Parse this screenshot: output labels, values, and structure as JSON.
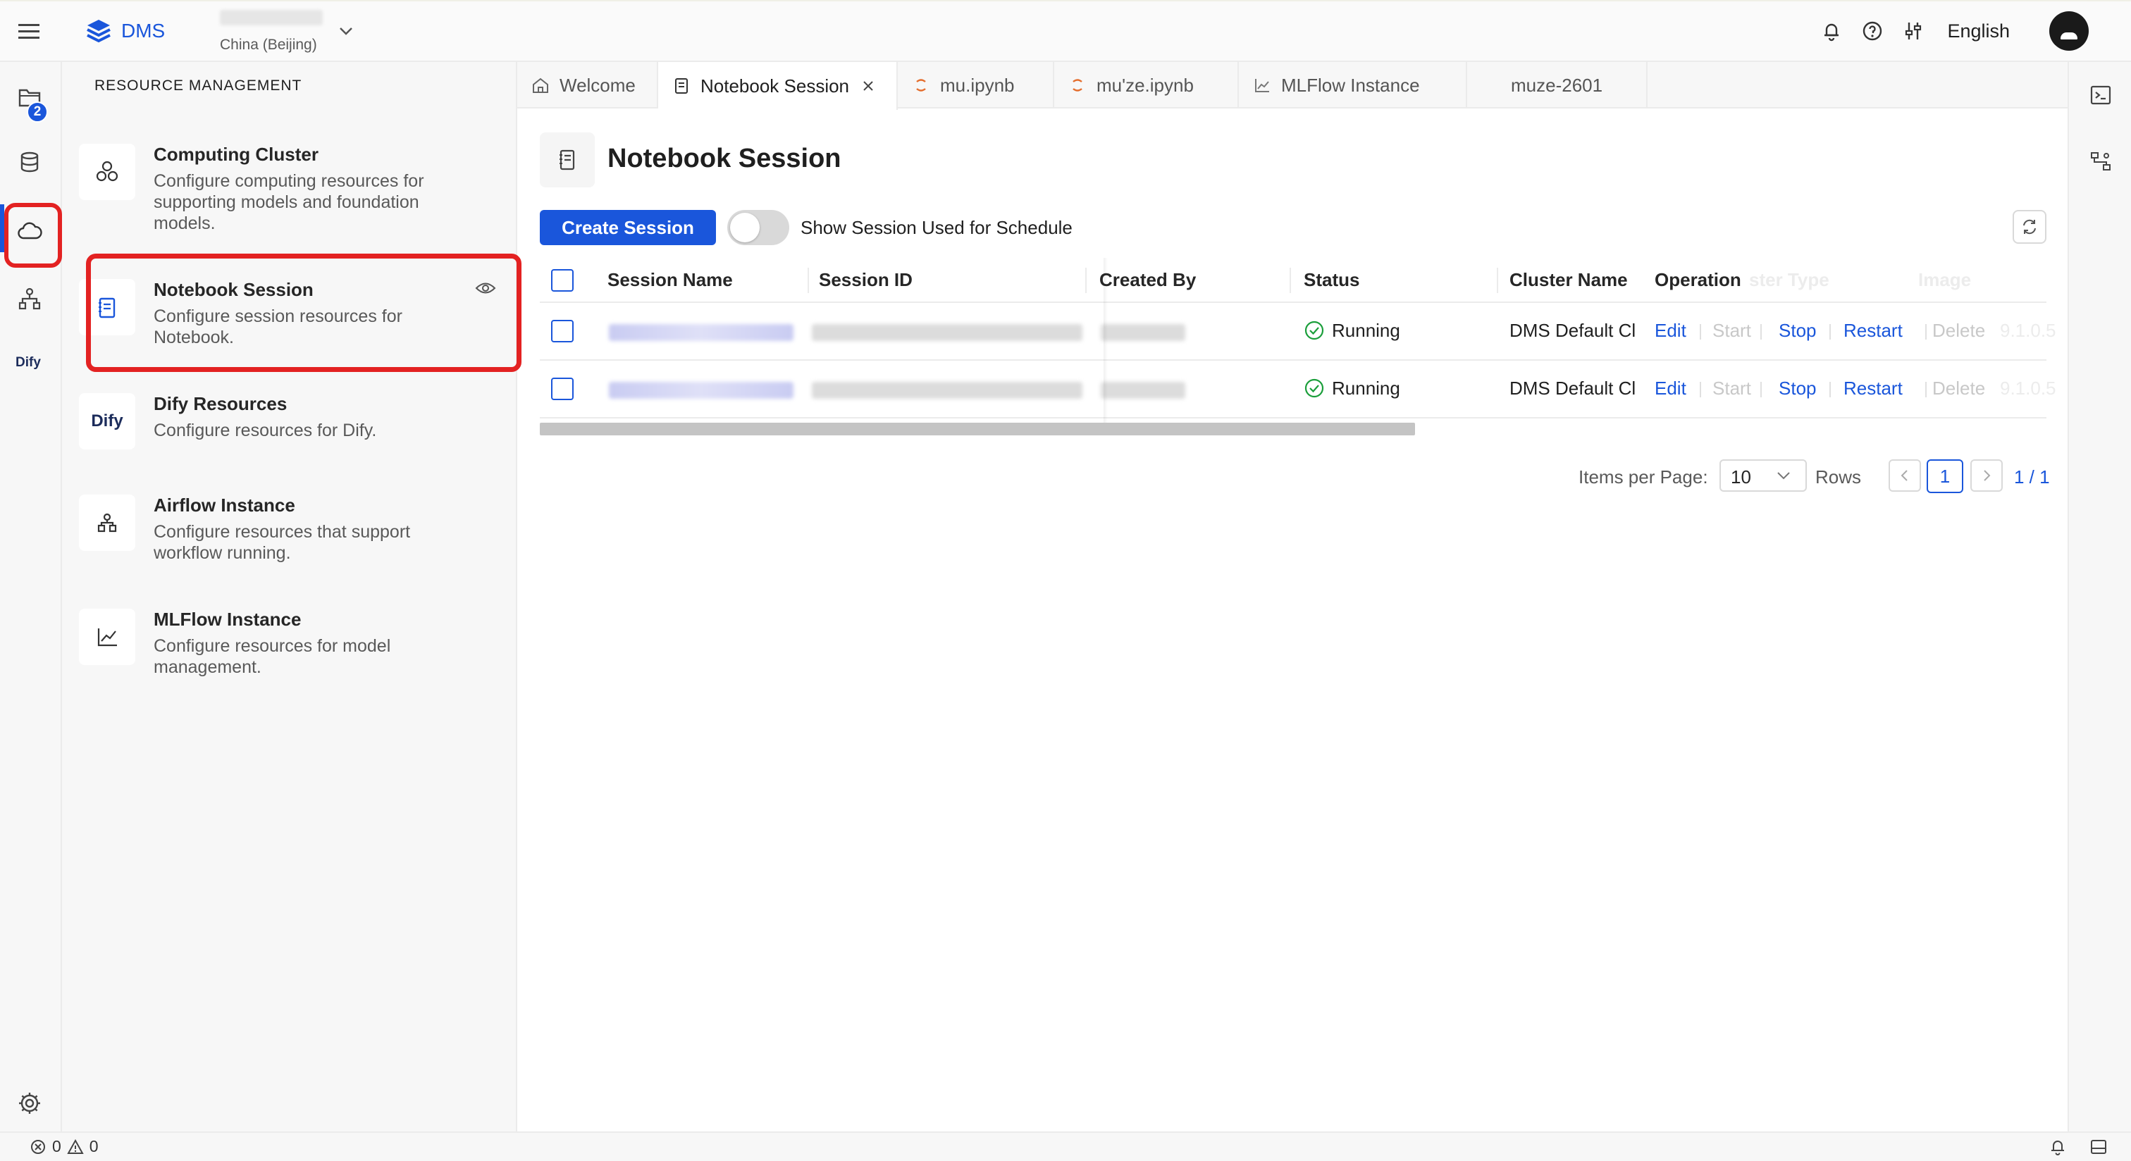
{
  "app": {
    "name": "DMS",
    "region": "China (Beijing)",
    "language": "English"
  },
  "rail": {
    "badge_count": "2",
    "dify_label": "Dify"
  },
  "panel": {
    "title": "RESOURCE MANAGEMENT",
    "items": [
      {
        "title": "Computing Cluster",
        "desc": "Configure computing resources for supporting models and foundation models."
      },
      {
        "title": "Notebook Session",
        "desc": "Configure session resources for Notebook."
      },
      {
        "title": "Dify Resources",
        "desc": "Configure resources for Dify.",
        "icon_text": "Dify"
      },
      {
        "title": "Airflow Instance",
        "desc": "Configure resources that support workflow running."
      },
      {
        "title": "MLFlow Instance",
        "desc": "Configure resources for model management."
      }
    ]
  },
  "tabs": [
    {
      "label": "Welcome",
      "icon": "home-icon"
    },
    {
      "label": "Notebook Session",
      "icon": "notebook-icon",
      "active": true
    },
    {
      "label": "mu.ipynb",
      "icon": "jupyter-icon"
    },
    {
      "label": "mu'ze.ipynb",
      "icon": "jupyter-icon"
    },
    {
      "label": "MLFlow Instance",
      "icon": "chart-icon"
    },
    {
      "label": "muze-2601",
      "icon": ""
    }
  ],
  "main": {
    "title": "Notebook Session",
    "create_label": "Create Session",
    "toggle_label": "Show Session Used for Schedule"
  },
  "table": {
    "columns": [
      "Session Name",
      "Session ID",
      "Created By",
      "Status",
      "Cluster Name",
      "Operation"
    ],
    "hidden_columns": [
      "ster Type",
      "Image"
    ],
    "rows": [
      {
        "status": "Running",
        "cluster": "DMS Default Cl",
        "image_tail": "9.1.0.5"
      },
      {
        "status": "Running",
        "cluster": "DMS Default Cl",
        "image_tail": "9.1.0.5"
      }
    ],
    "operations": {
      "edit": "Edit",
      "start": "Start",
      "stop": "Stop",
      "restart": "Restart",
      "delete": "Delete"
    }
  },
  "pagination": {
    "items_label": "Items per Page:",
    "page_size": "10",
    "rows_label": "Rows",
    "current": "1",
    "total": "1 / 1"
  },
  "statusbar": {
    "errors": "0",
    "warnings": "0"
  },
  "colors": {
    "accent": "#1a56db",
    "highlight": "#e32222",
    "success": "#1a9e3a"
  }
}
